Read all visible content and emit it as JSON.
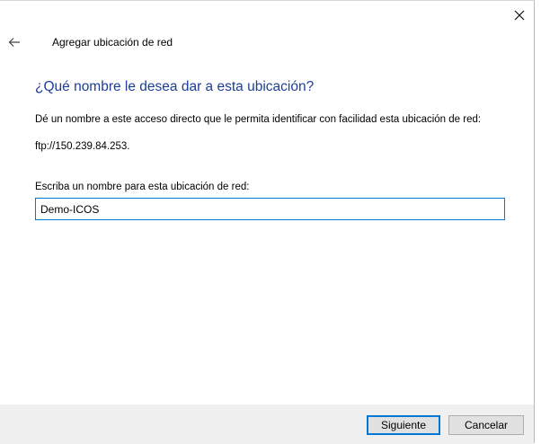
{
  "window": {
    "title": "Agregar ubicación de red",
    "close_icon": "close-icon",
    "back_icon": "back-arrow-icon"
  },
  "content": {
    "heading": "¿Qué nombre le desea dar a esta ubicación?",
    "description": "Dé un nombre a este acceso directo que le permita identificar con facilidad esta ubicación de red:",
    "address": "ftp://150.239.84.253.",
    "field_label": "Escriba un nombre para esta ubicación de red:",
    "field_value": "Demo-ICOS"
  },
  "footer": {
    "next_label": "Siguiente",
    "cancel_label": "Cancelar"
  },
  "colors": {
    "heading": "#1c3f94",
    "accent": "#0078d7",
    "footer_bg": "#f0f0f0"
  }
}
